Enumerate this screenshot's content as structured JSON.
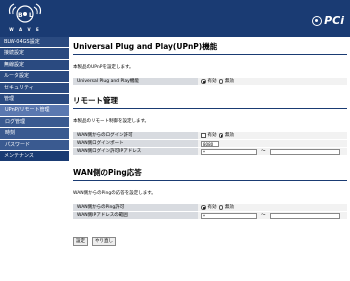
{
  "header": {
    "logo_text": "W A V E",
    "brand": "PCi"
  },
  "sidebar": {
    "items": [
      {
        "label": "BLW-04GS設定",
        "type": "normal"
      },
      {
        "label": "接続設定",
        "type": "normal"
      },
      {
        "label": "無線設定",
        "type": "normal"
      },
      {
        "label": "ルータ設定",
        "type": "normal"
      },
      {
        "label": "セキュリティ",
        "type": "normal"
      },
      {
        "label": "管理",
        "type": "normal"
      },
      {
        "label": "UPnP/リモート管理",
        "type": "active"
      },
      {
        "label": "ログ管理",
        "type": "sub"
      },
      {
        "label": "時刻",
        "type": "sub"
      },
      {
        "label": "パスワード",
        "type": "sub"
      },
      {
        "label": "メンテナンス",
        "type": "last"
      }
    ]
  },
  "upnp": {
    "title": "Universal Plug and Play(UPnP)機能",
    "desc": "本製品のUPnPを設定します。",
    "row_label": "Universal Plug and Play機能",
    "enable": "有効",
    "disable": "無効"
  },
  "remote": {
    "title": "リモート管理",
    "desc": "本製品のリモート制御を設定します。",
    "login_label": "WAN側からのログイン許可",
    "enable": "有効",
    "disable": "無効",
    "port_label": "WAN側ログインポート",
    "port_value": "8080",
    "addr_label": "WAN側ログイン許可IPアドレス",
    "addr_from": "*",
    "tilde": "～"
  },
  "ping": {
    "title": "WAN側のPing応答",
    "desc": "WAN側からのPingの応答を設定します。",
    "allow_label": "WAN側からのPing許可",
    "enable": "有効",
    "disable": "無効",
    "range_label": "WAN側IPアドレスの範囲",
    "range_from": "*",
    "tilde": "～"
  },
  "buttons": {
    "save": "設定",
    "reset": "やり直し"
  }
}
